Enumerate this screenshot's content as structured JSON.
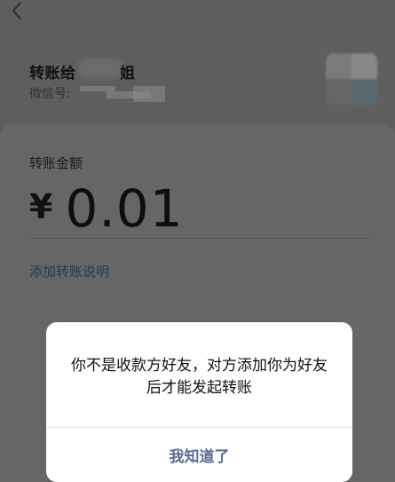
{
  "header": {
    "back_icon": "chevron-left-icon"
  },
  "recipient": {
    "label": "转账给",
    "name_tail": "姐",
    "wechat_id_label": "微信号:"
  },
  "transfer": {
    "amount_label": "转账金额",
    "currency_symbol": "¥",
    "amount": "0.01",
    "add_note_link": "添加转账说明"
  },
  "dialog": {
    "message": "你不是收款方好友，对方添加你为好友后才能发起转账",
    "confirm_button": "我知道了"
  },
  "colors": {
    "link": "#576b95",
    "overlay_background": "#5e5e5e",
    "dialog_background": "#ffffff"
  }
}
